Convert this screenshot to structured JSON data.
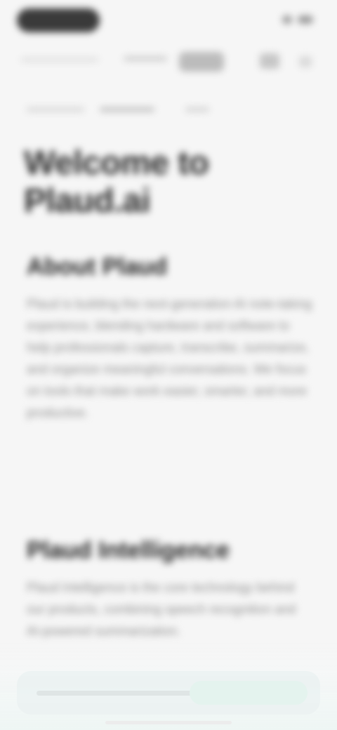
{
  "page": {
    "title": "Welcome to Plaud.ai"
  },
  "sections": [
    {
      "title": "About Plaud",
      "body": "Plaud is building the next-generation AI note-taking experience, blending hardware and software to help professionals capture, transcribe, summarize, and organize meaningful conversations. We focus on tools that make work easier, smarter, and more productive."
    },
    {
      "title": "Plaud Intelligence",
      "body": "Plaud Intelligence is the core technology behind our products, combining speech recognition and AI-powered summarization."
    }
  ]
}
